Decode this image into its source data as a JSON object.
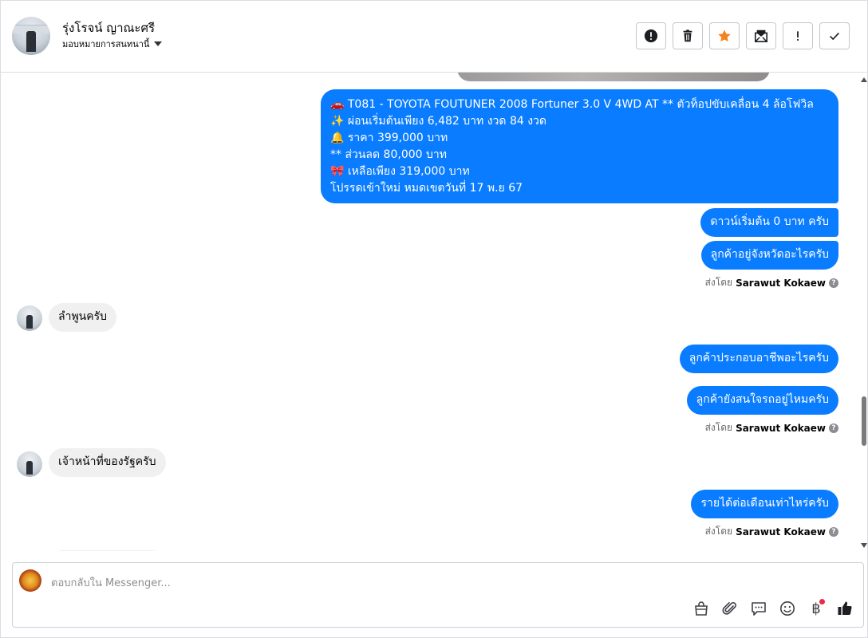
{
  "header": {
    "contact_name": "รุ่งโรจน์ ญาณะศรี",
    "assign_label": "มอบหมายการสนทนานี้",
    "actions": [
      "alert-circle-icon",
      "trash-icon",
      "star-icon",
      "mail-icon",
      "exclamation-icon",
      "check-icon"
    ]
  },
  "messages": {
    "listing_lines": [
      "🚗 T081 - TOYOTA FOUTUNER 2008 Fortuner 3.0 V 4WD AT ** ตัวท็อปขับเคลื่อน 4 ล้อโฟวิล",
      "✨ ผ่อนเริ่มต้นเพียง 6,482 บาท งวด 84 งวด",
      "🔔  ราคา 399,000 บาท",
      "** ส่วนลด 80,000 บาท",
      "🎀 เหลือเพียง 319,000 บาท",
      "โปรรดเข้าใหม่ หมดเขตวันที่ 17 พ.ย 67"
    ],
    "m_down": "ดาวน์เริ่มต้น 0 บาท ครับ",
    "m_province": "ลูกค้าอยู่จังหวัดอะไรครับ",
    "m_reply1": "ลำพูนครับ",
    "m_job": "ลูกค้าประกอบอาชีพอะไรครับ",
    "m_interest": "ลูกค้ายังสนใจรถอยู่ไหมครับ",
    "m_reply2": "เจ้าหน้าที่ของรัฐครับ",
    "m_income": "รายได้ต่อเดือนเท่าไหร่ครับ",
    "sent_by_prefix": "ส่งโดย",
    "sent_by_name": "Sarawut Kokaew",
    "help_glyph": "?"
  },
  "composer": {
    "placeholder": "ตอบกลับใน Messenger...",
    "tools": [
      "bag-icon",
      "paperclip-icon",
      "saved-reply-icon",
      "emoji-icon",
      "baht-icon",
      "like-icon"
    ],
    "baht_glyph": "฿"
  },
  "colors": {
    "outgoing": "#0a7cff",
    "incoming": "#f0f0f0",
    "accent_star": "#f5821f",
    "notify": "#f02849"
  }
}
